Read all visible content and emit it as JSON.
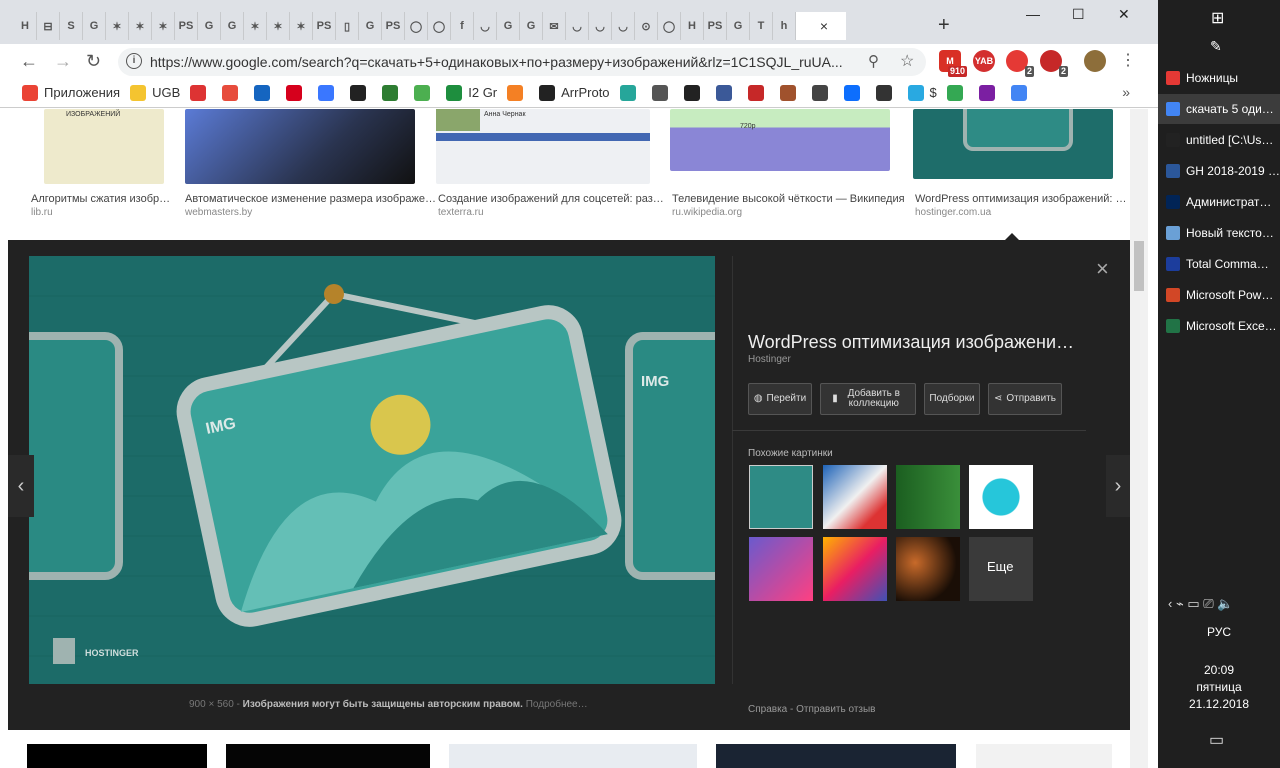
{
  "tabs": {
    "items": [
      "H",
      "⊟",
      "S",
      "G",
      "✶",
      "✶",
      "✶",
      "PS",
      "G",
      "G",
      "✶",
      "✶",
      "✶",
      "PS",
      "▯",
      "G",
      "PS",
      "◯",
      "◯",
      "f",
      "◡",
      "G",
      "G",
      "✉",
      "◡",
      "◡",
      "◡",
      "⊙",
      "◯",
      "H",
      "PS",
      "G",
      "T",
      "h"
    ],
    "active_close": "×",
    "new_tab": "+"
  },
  "window": {
    "minimize": "—",
    "maximize": "☐",
    "close": "✕"
  },
  "toolbar": {
    "back": "←",
    "forward": "→",
    "reload": "↻",
    "url": "https://www.google.com/search?q=скачать+5+одинаковых+по+размеру+изображений&rlz=1C1SQJL_ruUA...",
    "zoom_icon": "⚲",
    "star_icon": "☆",
    "menu_icon": "⋮",
    "ext_badges": [
      "910",
      "YAB",
      "2",
      "2"
    ]
  },
  "bookmarks": {
    "items": [
      {
        "label": "Приложения",
        "icon": "apps-icon",
        "color": "#ea4335"
      },
      {
        "label": "UGB",
        "icon": "folder-icon",
        "color": "#f4c430"
      },
      {
        "label": "",
        "icon": "thermometer-icon",
        "color": "#d33"
      },
      {
        "label": "",
        "icon": "r-icon",
        "color": "#e74c3c"
      },
      {
        "label": "",
        "icon": "target-icon",
        "color": "#1565c0"
      },
      {
        "label": "",
        "icon": "hh-icon",
        "color": "#d6001c"
      },
      {
        "label": "",
        "icon": "olx-icon",
        "color": "#3a77ff"
      },
      {
        "label": "",
        "icon": "eye-icon",
        "color": "#222"
      },
      {
        "label": "",
        "icon": "247-icon",
        "color": "#2e7d32"
      },
      {
        "label": "",
        "icon": "privat-icon",
        "color": "#4caf50"
      },
      {
        "label": "I2 Gr",
        "icon": "sheet-icon",
        "color": "#1e8e3e"
      },
      {
        "label": "",
        "icon": "stack-icon",
        "color": "#f48024"
      },
      {
        "label": "ArrProto",
        "icon": "bird-icon",
        "color": "#222"
      },
      {
        "label": "",
        "icon": "p-icon",
        "color": "#26a69a"
      },
      {
        "label": "",
        "icon": "hash-icon",
        "color": "#555"
      },
      {
        "label": "",
        "icon": "github-icon",
        "color": "#222"
      },
      {
        "label": "",
        "icon": "facebook-icon",
        "color": "#3b5998"
      },
      {
        "label": "",
        "icon": "tower-icon",
        "color": "#c62828"
      },
      {
        "label": "",
        "icon": "office-icon",
        "color": "#a0522d"
      },
      {
        "label": "",
        "icon": "book-icon",
        "color": "#444"
      },
      {
        "label": "",
        "icon": "b-icon",
        "color": "#0d6efd"
      },
      {
        "label": "",
        "icon": "mol-icon",
        "color": "#333"
      },
      {
        "label": "$",
        "icon": "h-icon",
        "color": "#29a9e1"
      },
      {
        "label": "",
        "icon": "maps-icon",
        "color": "#34a853"
      },
      {
        "label": "",
        "icon": "plane-icon",
        "color": "#7b1fa2"
      },
      {
        "label": "",
        "icon": "google-icon",
        "color": "#4285f4"
      }
    ],
    "more": "»"
  },
  "results": [
    {
      "title": "Алгоритмы сжатия изобр…",
      "source": "lib.ru",
      "img_text": "ИЗОБРАЖЕНИЙ"
    },
    {
      "title": "Автоматическое изменение размера изображе…",
      "source": "webmasters.by",
      "img_text": ""
    },
    {
      "title": "Создание изображений для соцсетей: раз…",
      "source": "texterra.ru",
      "img_text": "Анна Чернак"
    },
    {
      "title": "Телевидение высокой чёткости — Википедия",
      "source": "ru.wikipedia.org",
      "img_text": "720p"
    },
    {
      "title": "WordPress оптимизация изображений: …",
      "source": "hostinger.com.ua",
      "img_text": ""
    }
  ],
  "panel": {
    "title": "WordPress оптимизация изображени…",
    "site": "Hostinger",
    "buttons": {
      "visit": "Перейти",
      "collect": "Добавить в коллекцию",
      "collections": "Подборки",
      "share": "Отправить"
    },
    "similar_label": "Похожие картинки",
    "more_label": "Еще",
    "close": "×",
    "prev": "‹",
    "next": "›",
    "img_label": "IMG",
    "brand": "HOSTINGER",
    "dims": "900 × 560",
    "copyright": "Изображения могут быть защищены авторским правом.",
    "more_info": "Подробнее…",
    "help": "Справка",
    "feedback": "Отправить отзыв",
    "dash": " - "
  },
  "taskbar": {
    "items": [
      {
        "label": "Ножницы",
        "icon": "scissors-icon",
        "color": "#e53935"
      },
      {
        "label": "скачать 5 оди…",
        "icon": "chrome-icon",
        "color": "#4285f4",
        "active": true
      },
      {
        "label": "untitled [C:\\Us…",
        "icon": "ps-icon",
        "color": "#222"
      },
      {
        "label": "GH 2018-2019 …",
        "icon": "word-icon",
        "color": "#2b579a"
      },
      {
        "label": "Администрат…",
        "icon": "powershell-icon",
        "color": "#012456"
      },
      {
        "label": "Новый тексто…",
        "icon": "notepad-icon",
        "color": "#6aa0d6"
      },
      {
        "label": "Total Comma…",
        "icon": "tc-icon",
        "color": "#1c3d9c"
      },
      {
        "label": "Microsoft Pow…",
        "icon": "powerpoint-icon",
        "color": "#d24726"
      },
      {
        "label": "Microsoft Exce…",
        "icon": "excel-icon",
        "color": "#217346"
      }
    ],
    "tray": "‹  ⌁  ▭  ⎚  🔈",
    "lang": "РУС",
    "time": "20:09",
    "day": "пятница",
    "date": "21.12.2018"
  }
}
